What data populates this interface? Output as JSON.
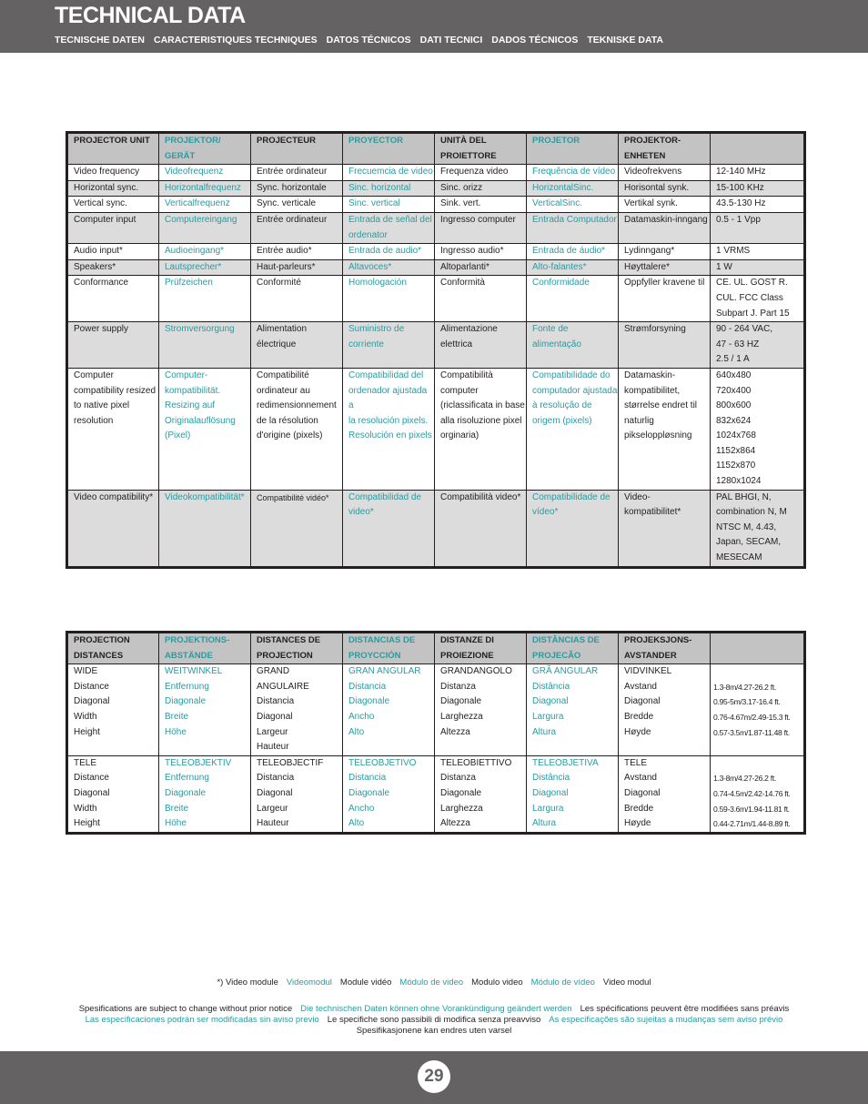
{
  "header": {
    "title": "TECHNICAL DATA",
    "subtitles": [
      "TECNISCHE DATEN",
      "CARACTERISTIQUES TECHNIQUES",
      "DATOS TÉCNICOS",
      "DATI TECNICI",
      "DADOS TÉCNICOS",
      "TEKNISKE DATA"
    ]
  },
  "colors": {
    "banner": "#646263",
    "accent_teal": "#2a9ba0",
    "header_row": "#c3c3c3",
    "alt_row": "#dcdcdc",
    "border": "#231f20"
  },
  "projector_table": {
    "headers": [
      "PROJECTOR UNIT",
      "PROJEKTOR/\nGERÄT",
      "PROJECTEUR",
      "PROYECTOR",
      "UNITÀ DEL\nPROIETTORE",
      "PROJETOR",
      "PROJEKTOR-\nENHETEN",
      ""
    ],
    "rows": [
      [
        "Video frequency",
        "Videofrequenz",
        "Entrée ordinateur",
        "Frecuemcia de video",
        "Frequenza video",
        "Frequência de vídeo",
        "Videofrekvens",
        "12-140 MHz"
      ],
      [
        "Horizontal sync.",
        "Horizontalfrequenz",
        "Sync. horizontale",
        "Sinc. horizontal",
        "Sinc. orizz",
        "HorizontalSinc.",
        "Horisontal synk.",
        "15-100 KHz"
      ],
      [
        "Vertical sync.",
        "Verticalfrequenz",
        "Sync. verticale",
        "Sinc. vertical",
        "Sink. vert.",
        "VerticalSinc.",
        "Vertikal synk.",
        "43.5-130 Hz"
      ],
      [
        "Computer input",
        "Computereingang",
        "Entrée ordinateur",
        "Entrada de señal del ordenator",
        "Ingresso computer",
        "Entrada Computador",
        "Datamaskin-inngang",
        "0.5 - 1 Vpp"
      ],
      [
        "Audio input*",
        "Audioeingang*",
        "Entrée audio*",
        "Entrada de audio*",
        "Ingresso audio*",
        "Entrada de áudio*",
        "Lydinngang*",
        "1 VRMS"
      ],
      [
        "Speakers*",
        "Lautsprecher*",
        "Haut-parleurs*",
        "Altavoces*",
        "Altoparlanti*",
        "Alto-falantes*",
        "Høyttalere*",
        "1 W"
      ],
      [
        "Conformance",
        "Prüfzeichen",
        "Conformité",
        "Homologación",
        "Conformità",
        "Conformidade",
        "Oppfyller kravene til",
        "CE. UL. GOST R.\nCUL. FCC Class\nSubpart J. Part 15"
      ],
      [
        "Power supply",
        "Stromversorgung",
        "Alimentation\nélectrique",
        "Suministro de\ncorriente",
        "Alimentazione\nelettrica",
        "Fonte de\nalimentação",
        "Strømforsyning",
        "90 - 264 VAC,\n47 - 63 HZ\n2.5 / 1 A"
      ],
      [
        "Computer\ncompatibility resized\nto native pixel\nresolution",
        "Computer-\nkompatibilität.\nResizing auf\nOriginalauflösung\n(Pixel)",
        "Compatibilité\nordinateur au\nredimensionnement\nde la résolution\nd'origine (pixels)",
        "Compatibilidad del\nordenador ajustada a\nla resolución pixels.\nResolución en pixels",
        "Compatibilità\ncomputer\n(riclassificata in base\nalla risoluzione pixel\norginaria)",
        "Compatibilidade do\ncomputador ajustada\nà resolução de\norigem (pixels)",
        "Datamaskin-\nkompatibilitet,\nstørrelse endret til\nnaturlig\npikseloppløsning",
        "640x480\n720x400\n800x600\n832x624\n1024x768\n1152x864\n1152x870\n1280x1024"
      ],
      [
        "Video compatibility*",
        "Videokompatibilität*",
        "Compatibilité vidéo*",
        "Compatibilidad de\nvideo*",
        "Compatibilità video*",
        "Compatibilidade de\nvídeo*",
        "Video-\nkompatibilitet*",
        "PAL BHGI, N,\ncombination N, M\nNTSC M, 4.43,\nJapan, SECAM,\nMESECAM"
      ]
    ]
  },
  "distance_table": {
    "headers": [
      "PROJECTION\nDISTANCES",
      "PROJEKTIONS-\nABSTÄNDE",
      "DISTANCES DE\nPROJECTION",
      "DISTANCIAS DE\nPROYCCIÓN",
      "DISTANZE DI\nPROIEZIONE",
      "DISTÂNCIAS DE\nPROJECÃO",
      "PROJEKSJONS-\nAVSTANDER",
      ""
    ],
    "groups": [
      {
        "cells": [
          "WIDE\nDistance\nDiagonal\nWidth\nHeight",
          "WEITWINKEL\nEntfernung\nDiagonale\nBreite\nHöhe",
          "GRAND ANGULAIRE\nDistancia\nDiagonal\nLargeur\nHauteur",
          "GRAN ANGULAR\nDistancia\nDiagonale\nAncho\nAlto",
          "GRANDANGOLO\nDistanza\nDiagonale\nLarghezza\nAltezza",
          "GRÃ ANGULAR\nDistância\nDiagonal\nLargura\nAltura",
          "VIDVINKEL\nAvstand\nDiagonal\nBredde\nHøyde",
          "1.3-8m/4.27-26.2 ft.\n0.95-5m/3.17-16.4 ft.\n0.76-4.67m/2.49-15.3 ft.\n0.57-3.5m/1.87-11.48 ft."
        ]
      },
      {
        "cells": [
          "TELE\nDistance\nDiagonal\nWidth\nHeight",
          "TELEOBJEKTIV\nEntfernung\nDiagonale\nBreite\nHöhe",
          "TELEOBJECTIF\nDistancia\nDiagonal\nLargeur\nHauteur",
          "TELEOBJETIVO\nDistancia\nDiagonale\nAncho\nAlto",
          "TELEOBIETTIVO\nDistanza\nDiagonale\nLarghezza\nAltezza",
          "TELEOBJETIVA\nDistância\nDiagonal\nLargura\nAltura",
          "TELE\nAvstand\nDiagonal\nBredde\nHøyde",
          "1.3-8m/4.27-26.2 ft.\n0.74-4.5m/2.42-14.76 ft.\n0.59-3.6m/1.94-11.81 ft.\n0.44-2.71m/1.44-8.89 ft."
        ]
      }
    ]
  },
  "notes": {
    "video_module": [
      "*) Video module",
      "Videomodul",
      "Module vidéo",
      "Módulo de video",
      "Modulo video",
      "Módulo de vídeo",
      "Video modul"
    ],
    "change_notice_line1": [
      "Spesifications are subject to change without prior notice",
      "Die technischen Daten können ohne Vorankündigung geändert werden",
      "Les spécifications peuvent être modifiées sans préavis"
    ],
    "change_notice_line2": [
      "Las especificaciones podrán ser modificadas sin aviso previo",
      "Le specifiche sono passibili di modifica senza preavviso",
      "As especificações são sujeitas a mudanças sem aviso prévio"
    ],
    "change_notice_line3": [
      "Spesifikasjonene kan endres uten varsel"
    ]
  },
  "footer": {
    "page_number": "29"
  }
}
